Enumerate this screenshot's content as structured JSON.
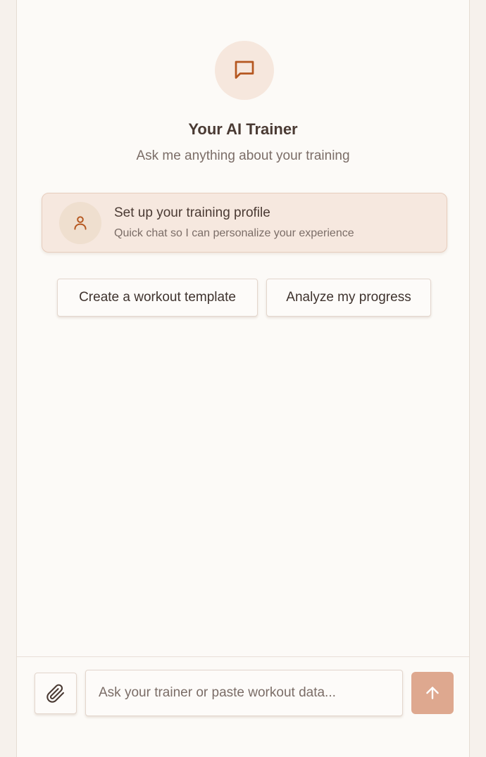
{
  "header": {
    "icon": "chat-bubble-icon",
    "title": "Your AI Trainer",
    "subtitle": "Ask me anything about your training"
  },
  "profile_card": {
    "icon": "user-icon",
    "title": "Set up your training profile",
    "subtitle": "Quick chat so I can personalize your experience"
  },
  "suggestions": [
    {
      "label": "Create a workout template"
    },
    {
      "label": "Analyze my progress"
    }
  ],
  "composer": {
    "attach_icon": "paperclip-icon",
    "placeholder": "Ask your trainer or paste workout data...",
    "value": "",
    "send_icon": "arrow-up-icon"
  },
  "colors": {
    "accent": "#b5571f",
    "send_button": "#dea88f",
    "icon_bg": "#f6e7dd",
    "background": "#fcfaf7"
  }
}
